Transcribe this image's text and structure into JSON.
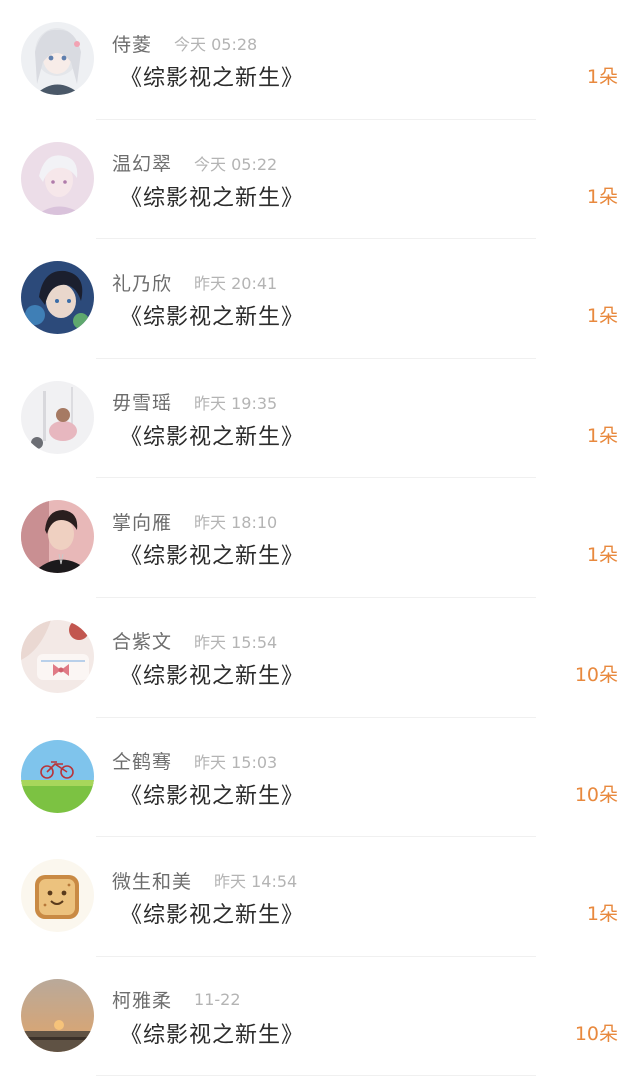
{
  "records": [
    {
      "user": "侍菱",
      "time": "今天 05:28",
      "title": "《综影视之新生》",
      "gift": "1朵",
      "avatar_icon": "anime-girl-avatar"
    },
    {
      "user": "温幻翠",
      "time": "今天 05:22",
      "title": "《综影视之新生》",
      "gift": "1朵",
      "avatar_icon": "anime-boy-avatar"
    },
    {
      "user": "礼乃欣",
      "time": "昨天 20:41",
      "title": "《综影视之新生》",
      "gift": "1朵",
      "avatar_icon": "dark-hair-boy-avatar"
    },
    {
      "user": "毋雪瑶",
      "time": "昨天 19:35",
      "title": "《综影视之新生》",
      "gift": "1朵",
      "avatar_icon": "illustration-avatar"
    },
    {
      "user": "掌向雁",
      "time": "昨天 18:10",
      "title": "《综影视之新生》",
      "gift": "1朵",
      "avatar_icon": "man-portrait-avatar"
    },
    {
      "user": "合紫文",
      "time": "昨天 15:54",
      "title": "《综影视之新生》",
      "gift": "10朵",
      "avatar_icon": "pink-bow-avatar"
    },
    {
      "user": "仝鹤骞",
      "time": "昨天 15:03",
      "title": "《综影视之新生》",
      "gift": "10朵",
      "avatar_icon": "bicycle-field-avatar"
    },
    {
      "user": "微生和美",
      "time": "昨天 14:54",
      "title": "《综影视之新生》",
      "gift": "1朵",
      "avatar_icon": "toast-face-avatar"
    },
    {
      "user": "柯雅柔",
      "time": "11-22",
      "title": "《综影视之新生》",
      "gift": "10朵",
      "avatar_icon": "sunset-avatar"
    }
  ],
  "colors": {
    "gift": "#e8893e",
    "name": "#6d6d6d",
    "time": "#b4b4b4",
    "title": "#2b2b2b"
  }
}
